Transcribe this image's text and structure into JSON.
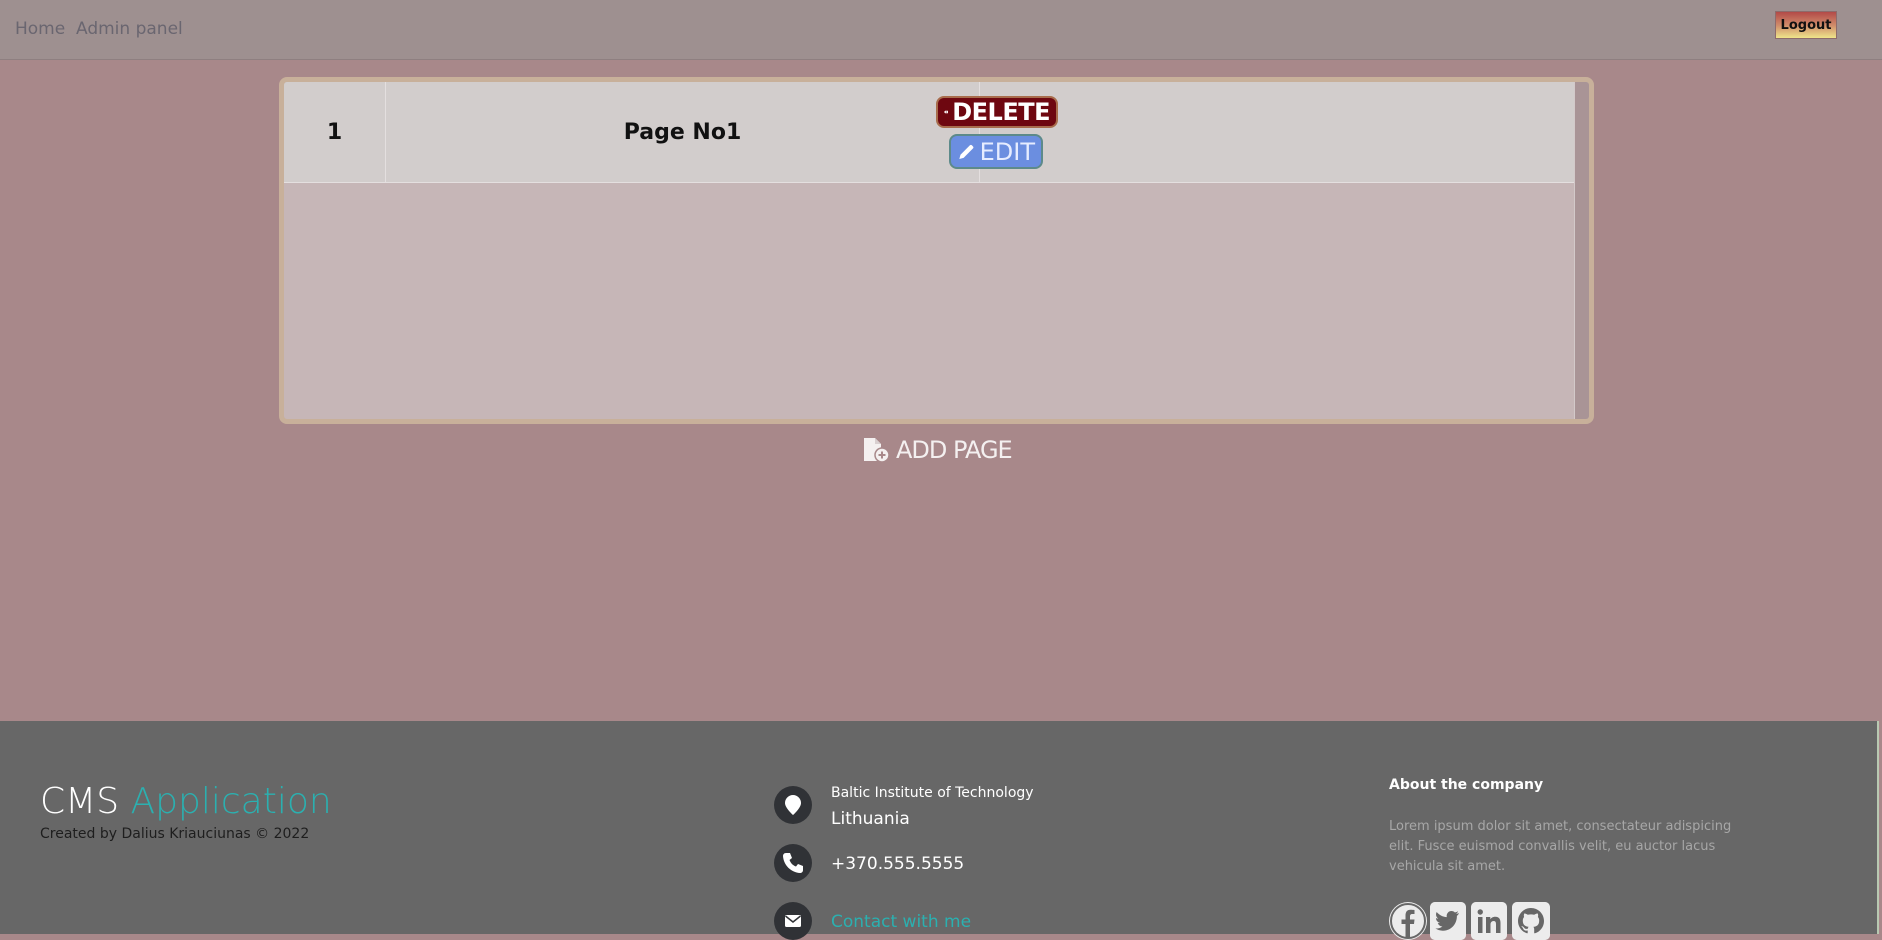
{
  "navbar": {
    "links": [
      {
        "label": "Home"
      },
      {
        "label": "Admin panel"
      }
    ],
    "logout_label": "Logout"
  },
  "pages_table": {
    "rows": [
      {
        "id": "1",
        "title": "Page No1",
        "delete_label": "DELETE",
        "edit_label": "EDIT"
      }
    ]
  },
  "add_page_label": "ADD PAGE",
  "footer": {
    "brand": {
      "part1": "CMS",
      "part2": "Application"
    },
    "created_by": "Created by Dalius Kriauciunas © 2022",
    "address_line1": "Baltic Institute of Technology",
    "address_line2": "Lithuania",
    "phone": "+370.555.5555",
    "contact_link": "Contact with me",
    "about_title": "About the company",
    "about_text": "Lorem ipsum dolor sit amet, consectateur adispicing elit. Fusce euismod convallis velit, eu auctor lacus vehicula sit amet.",
    "social_icons": [
      "facebook-icon",
      "twitter-icon",
      "linkedin-icon",
      "github-icon"
    ]
  },
  "colors": {
    "page_bg": "#a8888a",
    "accent": "#2bb0b0",
    "delete_bg": "#6e0710",
    "edit_bg": "#6b8ee0",
    "footer_bg": "#676767"
  }
}
